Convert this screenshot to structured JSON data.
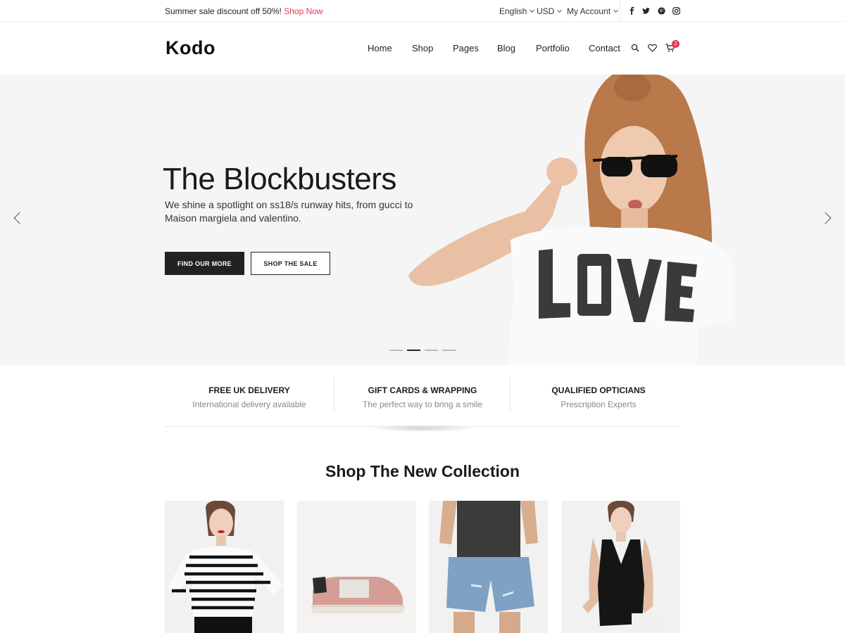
{
  "topbar": {
    "promo_text": "Summer sale discount off 50%!",
    "promo_link": "Shop Now",
    "language": "English",
    "currency": "USD",
    "account": "My Account",
    "social": [
      "facebook-icon",
      "twitter-icon",
      "pinterest-icon",
      "instagram-icon"
    ]
  },
  "header": {
    "logo": "Kodo",
    "nav": [
      "Home",
      "Shop",
      "Pages",
      "Blog",
      "Portfolio",
      "Contact"
    ],
    "cart_count": "2"
  },
  "hero": {
    "title": "The Blockbusters",
    "subtitle": "We shine a spotlight on ss18/s runway hits, from gucci to Maison margiela and valentino.",
    "primary_button": "FIND OUR MORE",
    "secondary_button": "SHOP THE SALE",
    "slide_count": 4,
    "active_slide": 2,
    "tshirt_text": "LOVE"
  },
  "features": [
    {
      "title": "FREE UK DELIVERY",
      "subtitle": "International delivery available"
    },
    {
      "title": "GIFT CARDS & WRAPPING",
      "subtitle": "The perfect way to bring a smile"
    },
    {
      "title": "QUALIFIED OPTICIANS",
      "subtitle": "Prescription Experts"
    }
  ],
  "collection": {
    "title": "Shop The New Collection"
  },
  "colors": {
    "accent": "#e8355a",
    "dark": "#222222",
    "hero_bg": "#f5f5f5"
  }
}
